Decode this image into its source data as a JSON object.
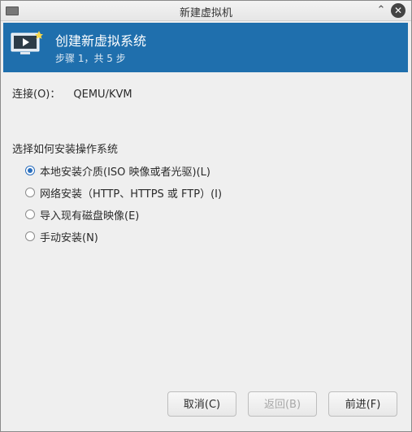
{
  "window": {
    "title": "新建虚拟机"
  },
  "banner": {
    "heading": "创建新虚拟系统",
    "step": "步骤 1，共 5 步"
  },
  "connection": {
    "label": "连接(O)：",
    "value": "QEMU/KVM"
  },
  "install": {
    "title": "选择如何安装操作系统",
    "options": [
      {
        "label": "本地安装介质(ISO 映像或者光驱)(L)",
        "checked": true
      },
      {
        "label": "网络安装（HTTP、HTTPS 或 FTP）(I)",
        "checked": false
      },
      {
        "label": "导入现有磁盘映像(E)",
        "checked": false
      },
      {
        "label": "手动安装(N)",
        "checked": false
      }
    ]
  },
  "buttons": {
    "cancel": "取消(C)",
    "back": "返回(B)",
    "forward": "前进(F)",
    "back_disabled": true
  },
  "icons": {
    "app": "virt-manager-icon",
    "minimize": "minimize-icon",
    "close": "close-icon",
    "banner": "monitor-play-icon"
  },
  "colors": {
    "banner_bg": "#1f6fad",
    "radio_accent": "#2a6ebd"
  }
}
